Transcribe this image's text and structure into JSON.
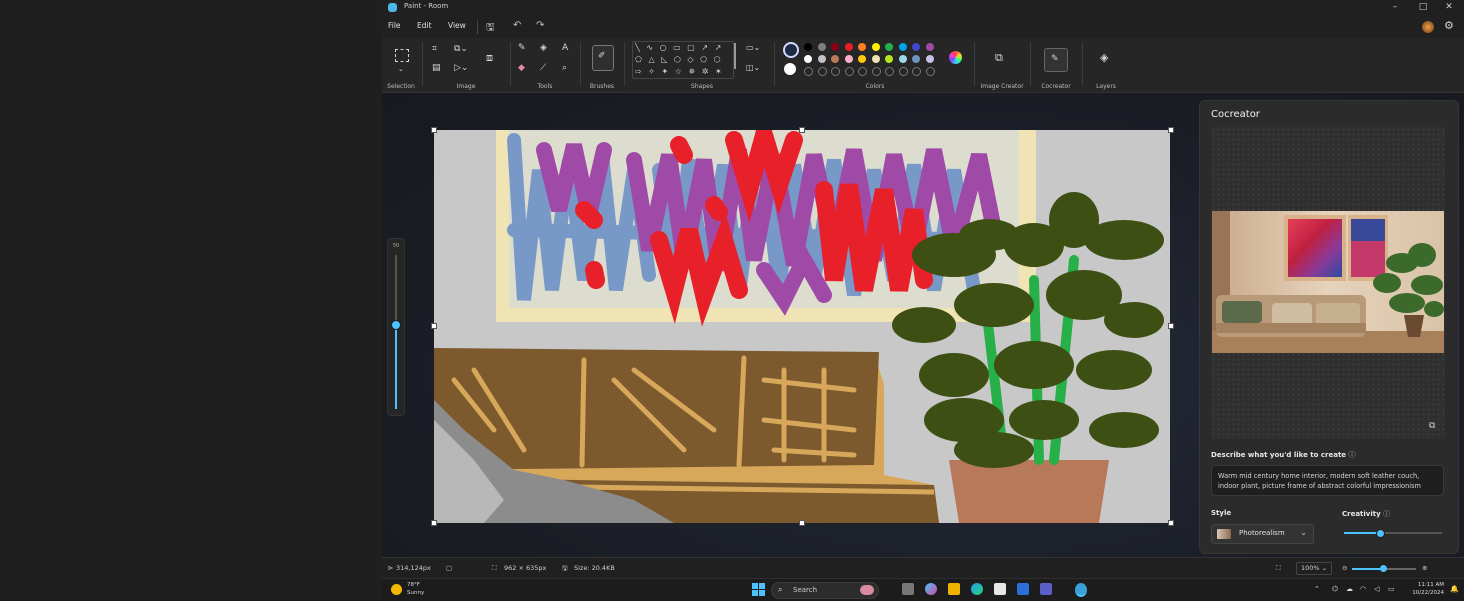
{
  "window": {
    "title": "Paint - Room"
  },
  "menu": {
    "file": "File",
    "edit": "Edit",
    "view": "View"
  },
  "ribbon": {
    "groups": [
      "Selection",
      "Image",
      "Tools",
      "Brushes",
      "Shapes",
      "Colors",
      "Image Creator",
      "Cocreator",
      "Layers"
    ]
  },
  "colors": {
    "primary": "#1c2a44",
    "secondary": "#ffffff",
    "palette_row1": [
      "#000000",
      "#7f7f7f",
      "#880015",
      "#ed1c24",
      "#ff7f27",
      "#fff200",
      "#22b14c",
      "#00a2e8",
      "#3f48cc",
      "#a349a4"
    ],
    "palette_row2": [
      "#ffffff",
      "#c3c3c3",
      "#b97a57",
      "#ffaec9",
      "#ffc90e",
      "#efe4b0",
      "#b5e61d",
      "#99d9ea",
      "#7092be",
      "#c8bfe7"
    ]
  },
  "cocreator": {
    "title": "Cocreator",
    "describe_label": "Describe what you'd like to create",
    "prompt": "Warm mid century home interior, modern soft leather couch, indoor plant, picture frame of abstract colorful impressionism",
    "style_label": "Style",
    "style_value": "Photorealism",
    "creativity_label": "Creativity",
    "creativity_level": 0.37
  },
  "status": {
    "cursor": "314,124px",
    "selection_size": "962 × 635px",
    "file_size": "Size: 20.4KB",
    "zoom": "100%",
    "zoom_level": 0.5
  },
  "brush_slider": {
    "label": "50",
    "level": 0.55
  },
  "taskbar": {
    "temp": "78°F",
    "weather": "Sunny",
    "search": "Search",
    "time": "11:11 AM",
    "date": "10/22/2024"
  }
}
